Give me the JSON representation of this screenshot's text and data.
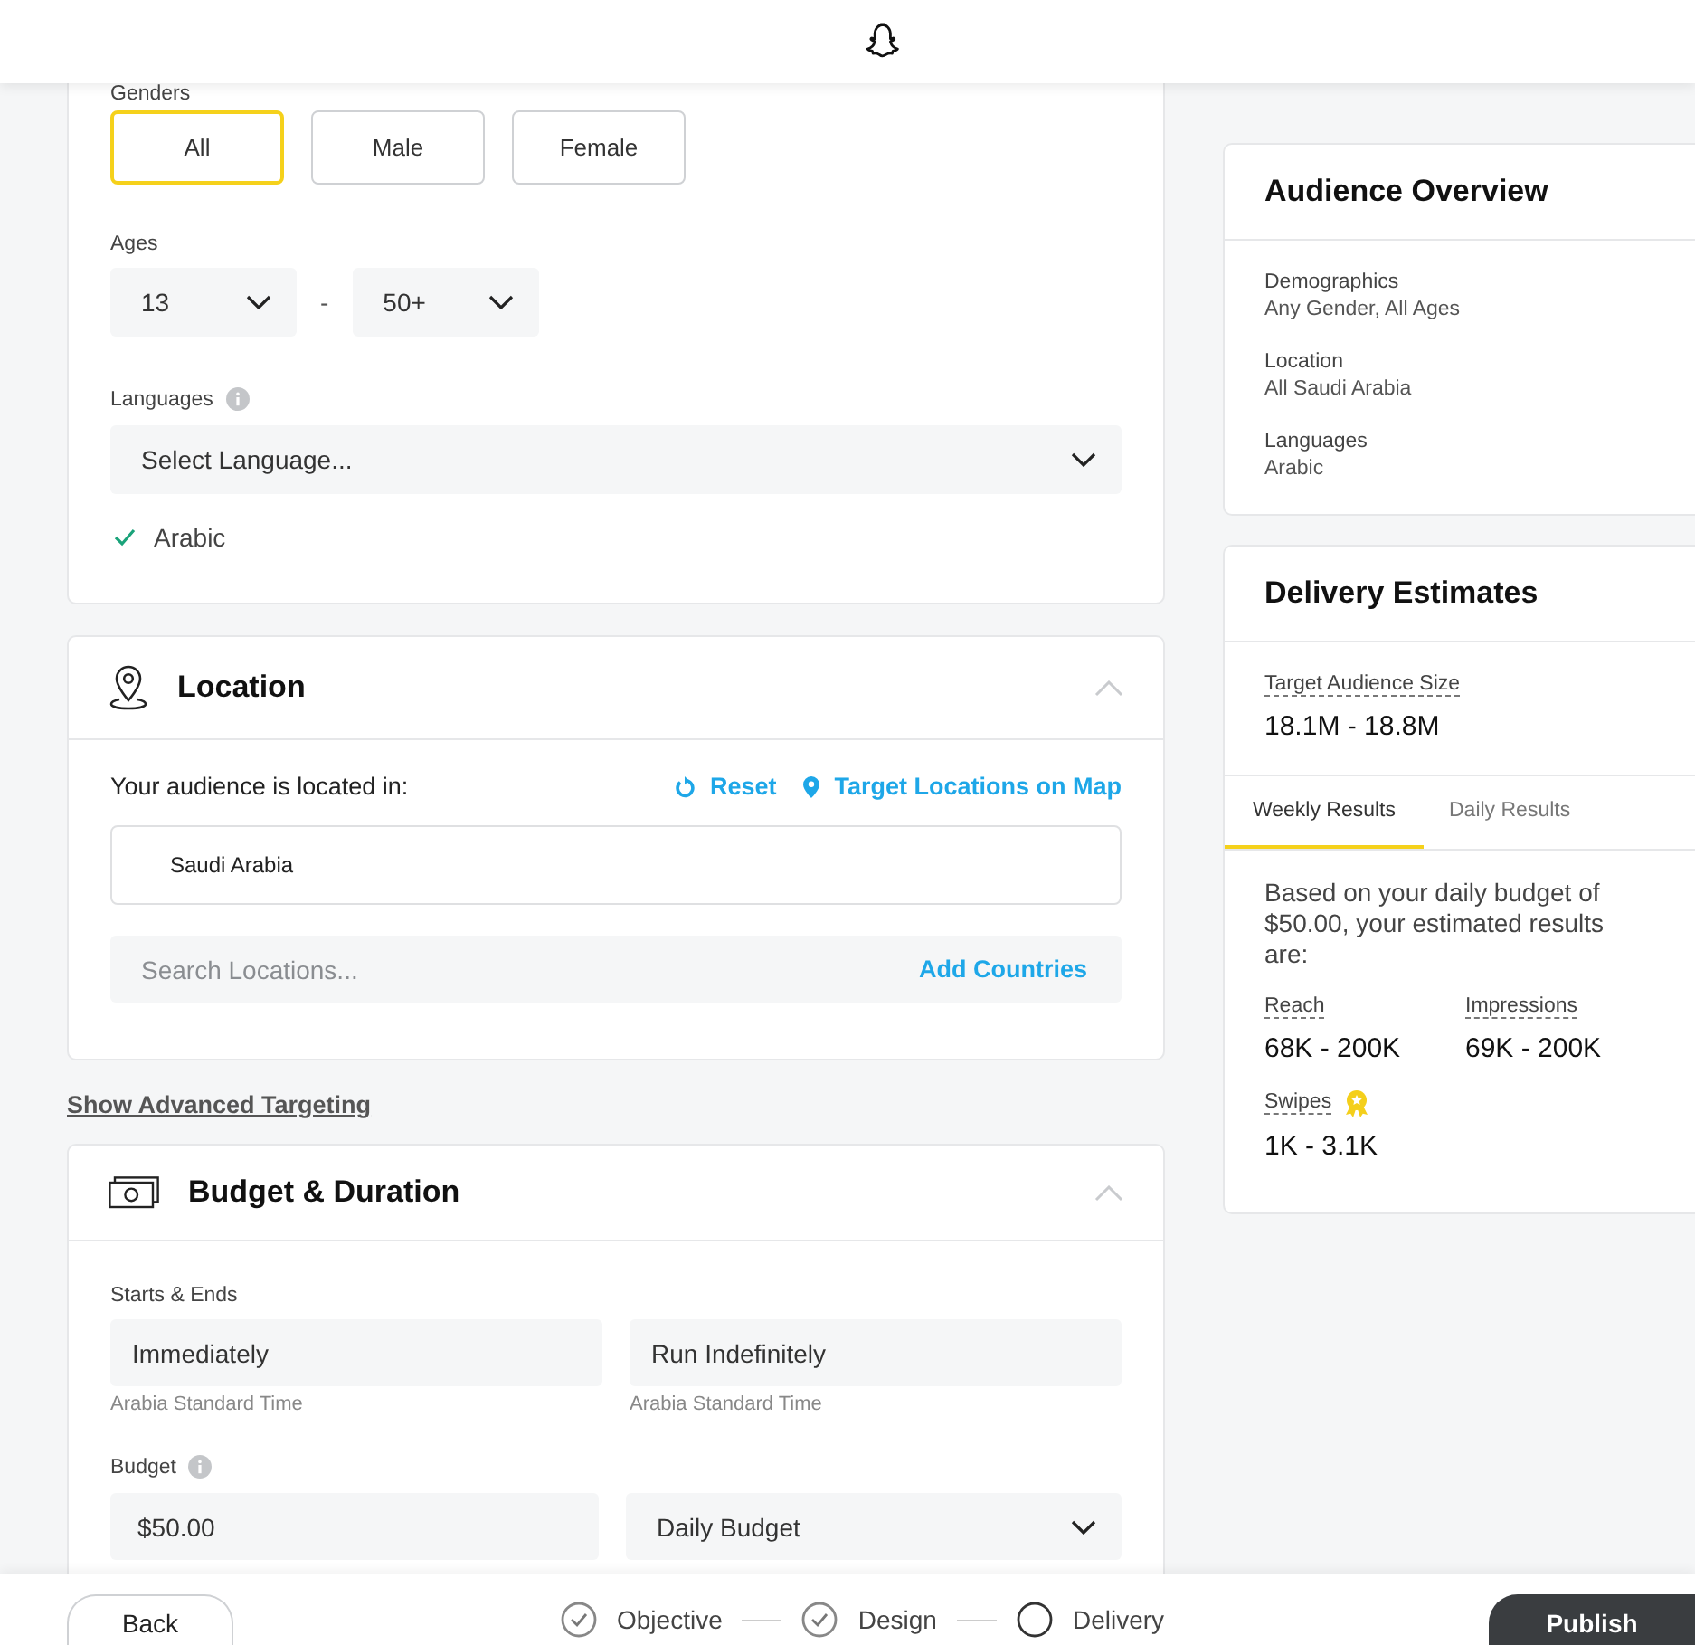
{
  "demographics": {
    "genders_label": "Genders",
    "genders": [
      {
        "label": "All",
        "selected": true
      },
      {
        "label": "Male",
        "selected": false
      },
      {
        "label": "Female",
        "selected": false
      }
    ],
    "ages_label": "Ages",
    "age_min": "13",
    "age_separator": "-",
    "age_max": "50+",
    "languages_label": "Languages",
    "language_placeholder": "Select Language...",
    "languages": [
      "Arabic"
    ]
  },
  "location": {
    "title": "Location",
    "expanded": true,
    "audience_label": "Your audience is located in:",
    "reset": "Reset",
    "map_link": "Target Locations on Map",
    "locations": [
      "Saudi Arabia"
    ],
    "search_placeholder": "Search Locations...",
    "add_button": "Add Countries"
  },
  "advanced_link": "Show Advanced Targeting",
  "budget": {
    "title": "Budget & Duration",
    "expanded": true,
    "schedule_label": "Starts & Ends",
    "start": "Immediately",
    "end": "Run Indefinitely",
    "start_timezone": "Arabia Standard Time",
    "end_timezone": "Arabia Standard Time",
    "budget_label": "Budget",
    "amount": "$50.00",
    "budget_type": "Daily Budget"
  },
  "overview": {
    "title": "Audience Overview",
    "items": [
      {
        "label": "Demographics",
        "value": "Any Gender, All Ages"
      },
      {
        "label": "Location",
        "value": "All Saudi Arabia"
      },
      {
        "label": "Languages",
        "value": "Arabic"
      }
    ]
  },
  "estimates": {
    "title": "Delivery Estimates",
    "audience_size_label": "Target Audience Size",
    "audience_size": "18.1M - 18.8M",
    "tabs": [
      {
        "label": "Weekly Results",
        "selected": true
      },
      {
        "label": "Daily Results",
        "selected": false
      }
    ],
    "summary": "Based on your daily budget of $50.00, your estimated results are:",
    "metrics": [
      {
        "label": "Reach",
        "value": "68K - 200K",
        "award": false
      },
      {
        "label": "Impressions",
        "value": "69K - 200K",
        "award": false
      },
      {
        "label": "Swipes",
        "value": "1K - 3.1K",
        "award": true
      }
    ]
  },
  "footer": {
    "back": "Back",
    "steps": [
      {
        "label": "Objective",
        "done": true
      },
      {
        "label": "Design",
        "done": true
      },
      {
        "label": "Delivery",
        "done": false
      }
    ],
    "publish": "Publish"
  }
}
